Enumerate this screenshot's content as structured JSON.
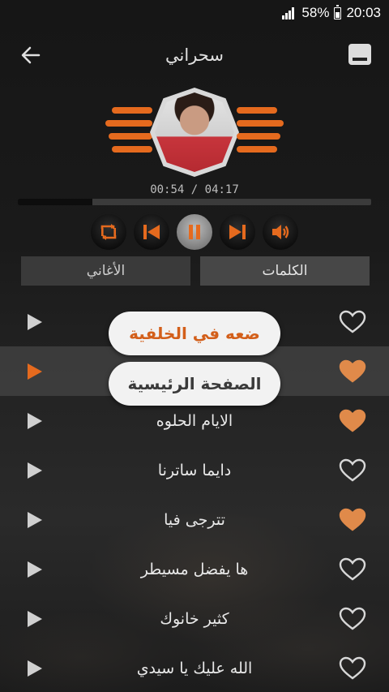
{
  "status_bar": {
    "battery": "58%",
    "time": "20:03"
  },
  "header": {
    "title": "سحراني"
  },
  "player": {
    "current_time": "00:54",
    "total_time": "04:17",
    "time_separator": " / ",
    "progress_fraction": 0.21
  },
  "tabs": [
    {
      "label": "الكلمات",
      "selected": true
    },
    {
      "label": "الأغاني",
      "selected": false
    }
  ],
  "songs": [
    {
      "title": "",
      "favorite": false,
      "highlighted": false
    },
    {
      "title": "",
      "favorite": true,
      "highlighted": true
    },
    {
      "title": "الايام الحلوه",
      "favorite": true,
      "highlighted": false
    },
    {
      "title": "دايما ساترنا",
      "favorite": false,
      "highlighted": false
    },
    {
      "title": "تترجى فيا",
      "favorite": true,
      "highlighted": false
    },
    {
      "title": "ها يفضل مسيطر",
      "favorite": false,
      "highlighted": false
    },
    {
      "title": "كثير خانوك",
      "favorite": false,
      "highlighted": false
    },
    {
      "title": "الله عليك يا سيدي",
      "favorite": false,
      "highlighted": false
    }
  ],
  "popup": {
    "background_label": "ضعه في الخلفية",
    "home_label": "الصفحة الرئيسية"
  },
  "colors": {
    "accent": "#e56a1e",
    "heart_filled": "#e08a4a",
    "heart_outline": "#d8d8d8"
  }
}
